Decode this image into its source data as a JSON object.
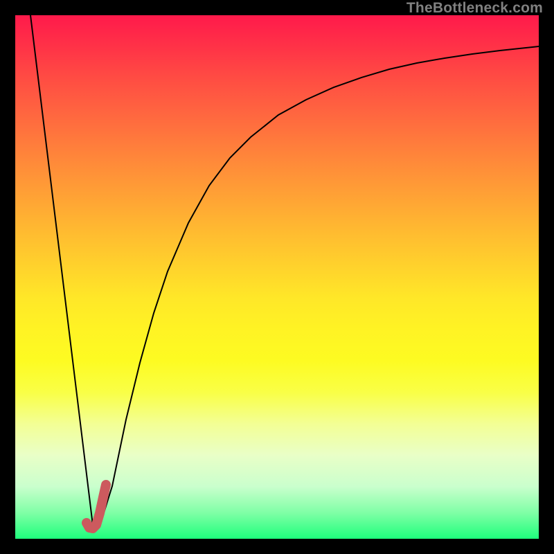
{
  "watermark": "TheBottleneck.com",
  "chart_data": {
    "type": "line",
    "title": "",
    "xlabel": "",
    "ylabel": "",
    "xlim": [
      0,
      100
    ],
    "ylim": [
      0,
      100
    ],
    "legend": false,
    "grid": false,
    "annotations": [],
    "series": [
      {
        "name": "descending-line",
        "color": "#000000",
        "x": [
          2.91,
          14.81
        ],
        "values": [
          100,
          2.65
        ]
      },
      {
        "name": "rising-curve",
        "color": "#000000",
        "x": [
          16.53,
          18.52,
          21.16,
          23.81,
          26.46,
          29.1,
          33.07,
          37.04,
          41.01,
          44.97,
          50.26,
          55.56,
          60.85,
          66.14,
          71.43,
          76.72,
          82.01,
          87.3,
          92.59,
          100.0
        ],
        "values": [
          3.7,
          10.05,
          22.75,
          33.6,
          43.12,
          51.06,
          60.32,
          67.46,
          72.75,
          76.72,
          80.95,
          83.86,
          86.24,
          88.1,
          89.68,
          90.87,
          91.8,
          92.59,
          93.25,
          94.05
        ]
      },
      {
        "name": "red-j-stroke",
        "color": "#cc5a5e",
        "stroke_width_px": 14,
        "x": [
          13.62,
          14.15,
          14.81,
          15.48,
          16.14,
          16.8,
          17.33
        ],
        "values": [
          3.04,
          2.12,
          1.98,
          2.65,
          4.89,
          7.94,
          10.32
        ]
      }
    ]
  }
}
